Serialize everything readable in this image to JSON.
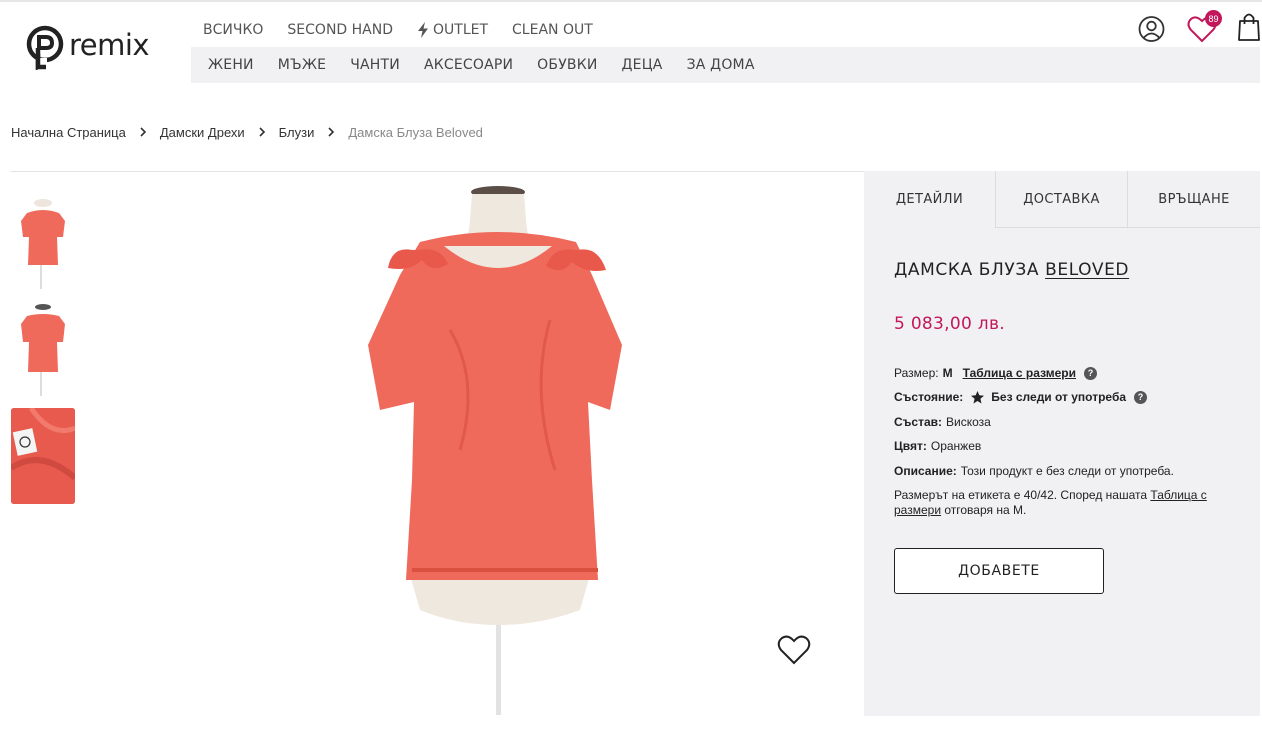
{
  "brand": {
    "logo_text": "remix"
  },
  "top_nav": [
    {
      "label": "ВСИЧКО"
    },
    {
      "label": "SECOND HAND"
    },
    {
      "label": "OUTLET",
      "icon": "lightning-icon"
    },
    {
      "label": "CLEAN OUT"
    }
  ],
  "categories": [
    {
      "label": "ЖЕНИ"
    },
    {
      "label": "МЪЖЕ"
    },
    {
      "label": "ЧАНТИ"
    },
    {
      "label": "АКСЕСОАРИ"
    },
    {
      "label": "ОБУВКИ"
    },
    {
      "label": "ДЕЦА"
    },
    {
      "label": "ЗА ДОМА"
    }
  ],
  "header_icons": {
    "wishlist_count": "89",
    "user": "user-icon",
    "wishlist": "heart-icon",
    "cart": "shopping-bag-icon"
  },
  "breadcrumb": [
    {
      "label": "Начална Страница"
    },
    {
      "label": "Дамски Дрехи"
    },
    {
      "label": "Блузи"
    },
    {
      "label": "Дамска Блуза Beloved"
    }
  ],
  "tabs": [
    {
      "label": "ДЕТАЙЛИ",
      "active": true
    },
    {
      "label": "ДОСТАВКА",
      "active": false
    },
    {
      "label": "ВРЪЩАНЕ",
      "active": false
    }
  ],
  "product": {
    "title_prefix": "ДАМСКА БЛУЗА",
    "brand": "BELOVED",
    "price": "5 083,00 лв.",
    "size_label": "Размер:",
    "size_value": "M",
    "size_chart_link": "Таблица с размери",
    "condition_label": "Състояние:",
    "condition_value": "Без следи от употреба",
    "composition_label": "Състав:",
    "composition_value": "Вискоза",
    "color_label": "Цвят:",
    "color_value": "Оранжев",
    "description_label": "Описание:",
    "description_value": "Този продукт е без следи от употреба.",
    "note_prefix": "Размерът на етикета е 40/42. Според нашата",
    "note_link": "Таблица с размери",
    "note_suffix": "отговаря на М.",
    "add_button": "ДОБАВЕТЕ"
  },
  "colors": {
    "accent": "#c2185b",
    "panel_bg": "#f1f1f3",
    "garment": "#f06a5c"
  }
}
